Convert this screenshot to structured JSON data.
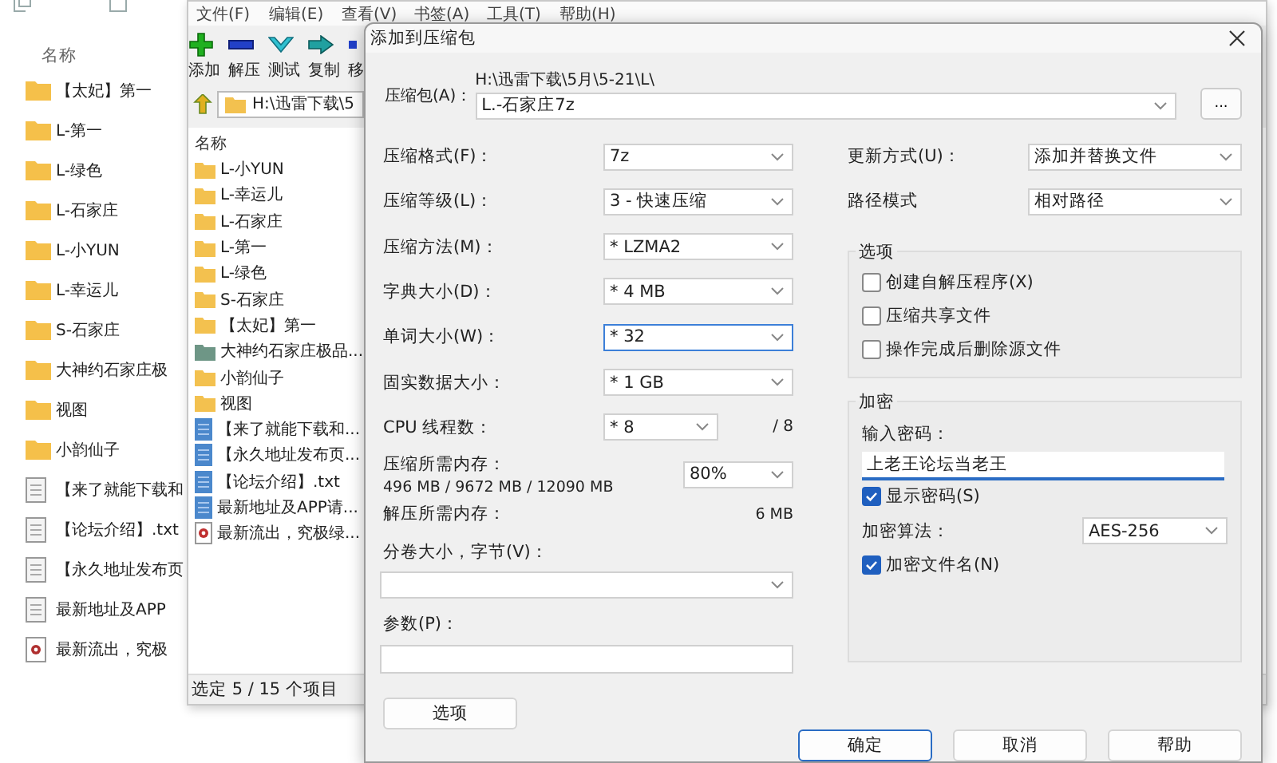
{
  "background_explorer": {
    "header": "名称",
    "items": [
      {
        "name": "【太妃】第一",
        "kind": "folder"
      },
      {
        "name": "L-第一",
        "kind": "folder"
      },
      {
        "name": "L-绿色",
        "kind": "folder"
      },
      {
        "name": "L-石家庄",
        "kind": "folder"
      },
      {
        "name": "L-小YUN",
        "kind": "folder"
      },
      {
        "name": "L-幸运儿",
        "kind": "folder"
      },
      {
        "name": "S-石家庄",
        "kind": "folder"
      },
      {
        "name": "大神约石家庄极",
        "kind": "folder"
      },
      {
        "name": "视图",
        "kind": "folder"
      },
      {
        "name": "小韵仙子",
        "kind": "folder"
      },
      {
        "name": "【来了就能下载和",
        "kind": "text"
      },
      {
        "name": "【论坛介绍】.txt",
        "kind": "text"
      },
      {
        "name": "【永久地址发布页",
        "kind": "text"
      },
      {
        "name": "最新地址及APP",
        "kind": "text"
      },
      {
        "name": "最新流出，究极",
        "kind": "media"
      }
    ]
  },
  "file_manager": {
    "menu": [
      "文件(F)",
      "编辑(E)",
      "查看(V)",
      "书签(A)",
      "工具(T)",
      "帮助(H)"
    ],
    "toolbar": [
      {
        "label": "添加",
        "kind": "add"
      },
      {
        "label": "解压",
        "kind": "extract"
      },
      {
        "label": "测试",
        "kind": "test"
      },
      {
        "label": "复制",
        "kind": "copy"
      },
      {
        "label": "移",
        "kind": "move"
      }
    ],
    "path": "H:\\迅雷下载\\5",
    "list_header": "名称",
    "items": [
      {
        "name": "L-小YUN",
        "kind": "folder"
      },
      {
        "name": "L-幸运儿",
        "kind": "folder"
      },
      {
        "name": "L-石家庄",
        "kind": "folder"
      },
      {
        "name": "L-第一",
        "kind": "folder"
      },
      {
        "name": "L-绿色",
        "kind": "folder"
      },
      {
        "name": "S-石家庄",
        "kind": "folder"
      },
      {
        "name": "【太妃】第一",
        "kind": "folder"
      },
      {
        "name": "大神约石家庄极品...",
        "kind": "dark-folder"
      },
      {
        "name": "小韵仙子",
        "kind": "folder"
      },
      {
        "name": "视图",
        "kind": "folder"
      },
      {
        "name": "【来了就能下载和...",
        "kind": "text"
      },
      {
        "name": "【永久地址发布页...",
        "kind": "text"
      },
      {
        "name": "【论坛介绍】.txt",
        "kind": "text"
      },
      {
        "name": "最新地址及APP请...",
        "kind": "text"
      },
      {
        "name": "最新流出，究极绿...",
        "kind": "media"
      }
    ],
    "status": "选定 5 / 15 个项目"
  },
  "dialog": {
    "title": "添加到压缩包",
    "archive_label": "压缩包(A)：",
    "archive_dir": "H:\\迅雷下载\\5月\\5-21\\L\\",
    "archive_name": "L.-石家庄7z",
    "browse_button": "...",
    "settings": [
      {
        "label": "压缩格式(F)：",
        "value": "7z",
        "focused": false
      },
      {
        "label": "压缩等级(L)：",
        "value": "3 - 快速压缩",
        "focused": false
      },
      {
        "label": "压缩方法(M)：",
        "value": "* LZMA2",
        "focused": false
      },
      {
        "label": "字典大小(D)：",
        "value": "* 4 MB",
        "focused": false
      },
      {
        "label": "单词大小(W)：",
        "value": "* 32",
        "focused": true
      },
      {
        "label": "固实数据大小：",
        "value": "* 1 GB",
        "focused": false
      }
    ],
    "cpu": {
      "label": "CPU 线程数：",
      "value": "* 8",
      "suffix": "/ 8"
    },
    "memory": {
      "label": "压缩所需内存：",
      "detail": "496 MB / 9672 MB / 12090 MB",
      "value": "80%"
    },
    "decompress": {
      "label": "解压所需内存：",
      "value": "6 MB"
    },
    "volume_label": "分卷大小，字节(V)：",
    "params_label": "参数(P)：",
    "options_button": "选项",
    "update_mode": {
      "label": "更新方式(U)：",
      "value": "添加并替换文件"
    },
    "path_mode": {
      "label": "路径模式",
      "value": "相对路径"
    },
    "options_group": {
      "title": "选项",
      "checkboxes": [
        {
          "label": "创建自解压程序(X)",
          "checked": false
        },
        {
          "label": "压缩共享文件",
          "checked": false
        },
        {
          "label": "操作完成后删除源文件",
          "checked": false
        }
      ]
    },
    "encryption": {
      "title": "加密",
      "password_label": "输入密码：",
      "password": "上老王论坛当老王",
      "show_password": {
        "label": "显示密码(S)",
        "checked": true
      },
      "method_label": "加密算法：",
      "method": "AES-256",
      "encrypt_names": {
        "label": "加密文件名(N)",
        "checked": true
      }
    },
    "buttons": [
      {
        "label": "确定",
        "focused": true
      },
      {
        "label": "取消",
        "focused": false
      },
      {
        "label": "帮助",
        "focused": false
      }
    ]
  }
}
